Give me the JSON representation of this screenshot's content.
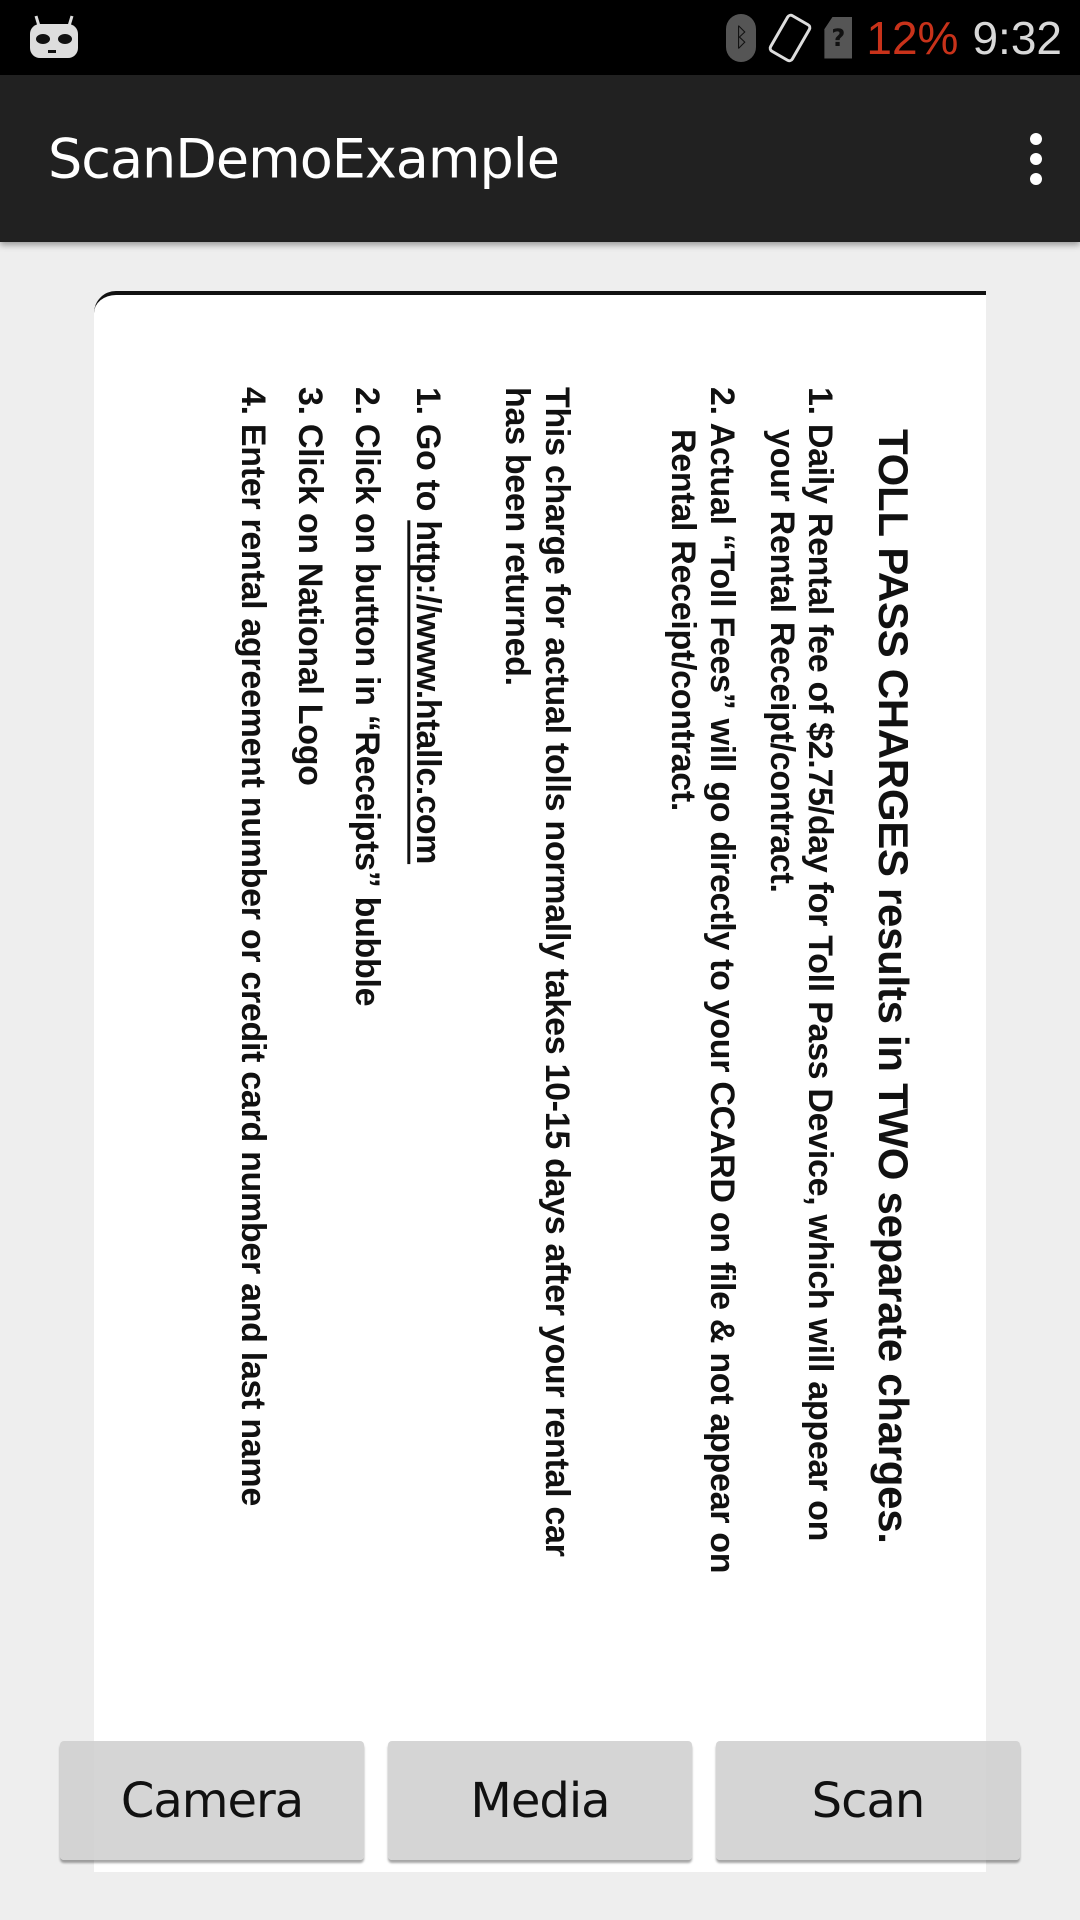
{
  "status_bar": {
    "battery": "12%",
    "time": "9:32",
    "battery_color": "#c8321a",
    "icons": [
      "cyanogen-robot-icon",
      "bluetooth-icon",
      "auto-rotate-icon",
      "no-sim-icon"
    ]
  },
  "app_bar": {
    "title": "ScanDemoExample",
    "menu_icon": "overflow-menu-icon"
  },
  "document": {
    "title": "TOLL PASS CHARGES results in TWO separate charges.",
    "lines": [
      "1. Daily Rental fee of $2.75/day for Toll Pass Device, which will appear on",
      "your Rental Receipt/contract.",
      "2. Actual “Toll Fees” will go directly to your CCARD on file & not appear on",
      "Rental Receipt/contract.",
      "This charge for actual tolls normally takes 10-15 days after your rental car",
      "has been returned."
    ],
    "steps": {
      "s1_prefix": "1. Go to ",
      "s1_link": "http://www.htallc.com",
      "s2": "2. Click on button in “Receipts” bubble",
      "s3": "3. Click on National Logo",
      "s4": "4. Enter rental agreement number or credit card number and last name"
    }
  },
  "buttons": {
    "camera": "Camera",
    "media": "Media",
    "scan": "Scan"
  }
}
